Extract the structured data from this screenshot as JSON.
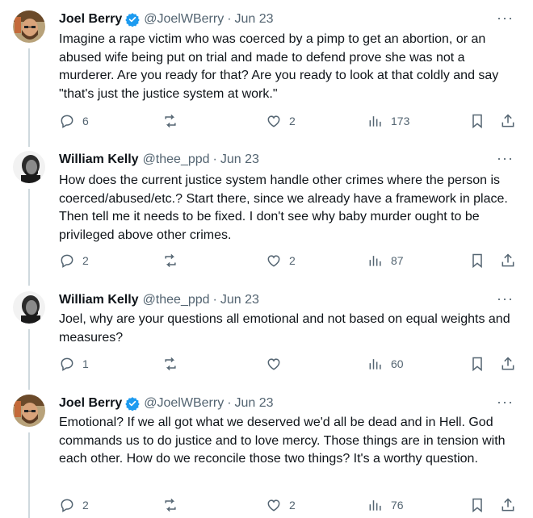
{
  "tweets": [
    {
      "name": "Joel Berry",
      "verified": true,
      "handle": "@JoelWBerry",
      "date": "Jun 23",
      "avatar": "joel-avatar",
      "text": "Imagine a rape victim who was coerced by a pimp to get an abortion, or an abused wife being put on trial and made to defend prove she was not a murderer. Are you ready for that? Are you ready to look at that coldly and say \"that's just the justice system at work.\"",
      "replies": "6",
      "reposts": "",
      "likes": "2",
      "views": "173"
    },
    {
      "name": "William Kelly",
      "verified": false,
      "handle": "@thee_ppd",
      "date": "Jun 23",
      "avatar": "william-avatar",
      "text": "How does the current justice system handle other crimes where the person is coerced/abused/etc.? Start there, since we already have a framework in place. Then tell me it needs to be fixed. I don't see why baby murder ought to be privileged above other crimes.",
      "replies": "2",
      "reposts": "",
      "likes": "2",
      "views": "87"
    },
    {
      "name": "William Kelly",
      "verified": false,
      "handle": "@thee_ppd",
      "date": "Jun 23",
      "avatar": "william-avatar",
      "text": "Joel, why are your questions all emotional and not based on equal weights and measures?",
      "replies": "1",
      "reposts": "",
      "likes": "",
      "views": "60"
    },
    {
      "name": "Joel Berry",
      "verified": true,
      "handle": "@JoelWBerry",
      "date": "Jun 23",
      "avatar": "joel-avatar",
      "text": "Emotional? If we all got what we deserved we'd all be dead and in Hell. God commands us to do justice and to love mercy. Those things are in tension with each other. How do we reconcile those two things? It's a worthy question.",
      "replies": "2",
      "reposts": "",
      "likes": "2",
      "views": "76"
    }
  ],
  "separator": "·",
  "more_label": "···",
  "colors": {
    "verified": "#1d9bf0",
    "muted": "#536471",
    "thread_line": "#cfd9de"
  },
  "icons": [
    "reply-icon",
    "repost-icon",
    "like-icon",
    "views-icon",
    "bookmark-icon",
    "share-icon",
    "verified-badge-icon",
    "more-icon"
  ]
}
